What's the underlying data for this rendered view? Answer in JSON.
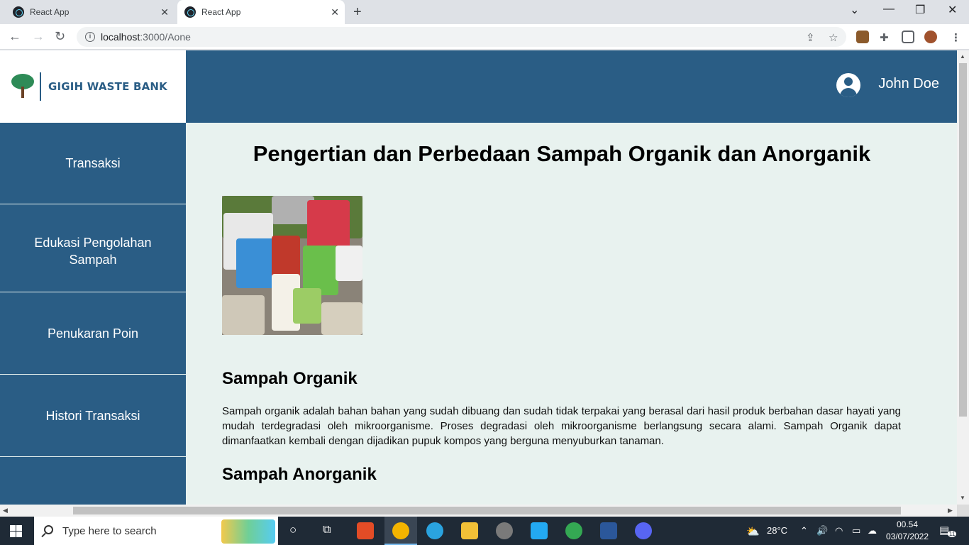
{
  "browser": {
    "tabs": [
      {
        "title": "React App",
        "active": false
      },
      {
        "title": "React App",
        "active": true
      }
    ],
    "url_host": "localhost",
    "url_path": ":3000/Aone"
  },
  "app": {
    "brand_name": "GIGIH WASTE BANK",
    "user_name": "John Doe"
  },
  "sidebar": {
    "items": [
      {
        "label": "Transaksi"
      },
      {
        "label": "Edukasi Pengolahan Sampah"
      },
      {
        "label": "Penukaran Poin"
      },
      {
        "label": "Histori Transaksi"
      }
    ]
  },
  "main": {
    "title": "Pengertian dan Perbedaan Sampah Organik dan Anorganik",
    "sections": [
      {
        "heading": "Sampah Organik",
        "body": "Sampah organik adalah bahan bahan yang sudah dibuang dan sudah tidak terpakai yang berasal dari hasil produk berbahan dasar hayati yang mudah terdegradasi oleh mikroorganisme. Proses degradasi oleh mikroorganisme berlangsung secara alami. Sampah Organik dapat dimanfaatkan kembali dengan dijadikan pupuk kompos yang berguna menyuburkan tanaman."
      },
      {
        "heading": "Sampah Anorganik",
        "body": ""
      }
    ]
  },
  "taskbar": {
    "search_placeholder": "Type here to search",
    "weather": "28°C",
    "time": "00.54",
    "date": "03/07/2022",
    "notification_count": "11"
  },
  "colors": {
    "primary": "#2a5d85",
    "page_bg": "#e8f2ef"
  }
}
